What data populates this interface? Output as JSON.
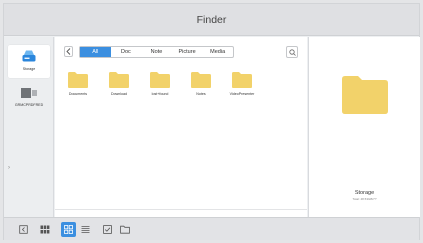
{
  "window": {
    "title": "Finder"
  },
  "sidebar": {
    "items": [
      {
        "label": "Storage",
        "icon": "storage-drive-icon",
        "selected": true
      },
      {
        "label": "GRMCPRDFRED",
        "icon": "external-device-icon",
        "selected": false
      }
    ],
    "collapse_icon": "chevron-right-icon"
  },
  "filter_tabs": [
    {
      "label": "All",
      "selected": true
    },
    {
      "label": "Doc",
      "selected": false
    },
    {
      "label": "Note",
      "selected": false
    },
    {
      "label": "Picture",
      "selected": false
    },
    {
      "label": "Media",
      "selected": false
    }
  ],
  "folders": [
    {
      "name": "Documents"
    },
    {
      "name": "Download"
    },
    {
      "name": "lost+found"
    },
    {
      "name": "Notes"
    },
    {
      "name": "VideoPresenter"
    }
  ],
  "detail": {
    "name": "Storage",
    "meta": "Total: 48.53GB/7?"
  },
  "toolbar": {
    "buttons": [
      {
        "icon": "exit-icon"
      },
      {
        "icon": "thumbnail-grid-icon"
      },
      {
        "icon": "grid-view-icon",
        "selected": true
      },
      {
        "icon": "list-view-icon"
      },
      {
        "icon": "select-checkbox-icon"
      },
      {
        "icon": "new-folder-icon"
      }
    ]
  },
  "colors": {
    "accent": "#3b8fe0",
    "folder": "#f2d26a",
    "background": "#eef0f2",
    "panel": "#ffffff"
  }
}
